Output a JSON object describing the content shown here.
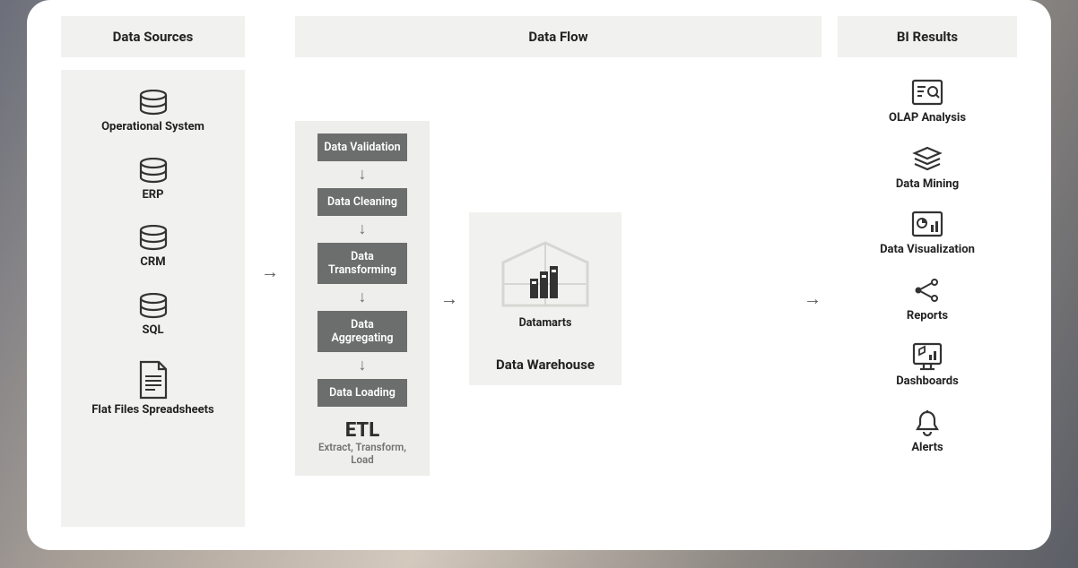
{
  "headers": {
    "sources": "Data Sources",
    "flow": "Data Flow",
    "results": "BI Results"
  },
  "sources": [
    {
      "label": "Operational System",
      "icon": "database"
    },
    {
      "label": "ERP",
      "icon": "database"
    },
    {
      "label": "CRM",
      "icon": "database"
    },
    {
      "label": "SQL",
      "icon": "database"
    },
    {
      "label": "Flat Files Spreadsheets",
      "icon": "file"
    }
  ],
  "etl": {
    "stages": [
      "Data Validation",
      "Data Cleaning",
      "Data Transforming",
      "Data Aggregating",
      "Data Loading"
    ],
    "title": "ETL",
    "subtitle": "Extract, Transform, Load"
  },
  "warehouse": {
    "datamarts_label": "Datamarts",
    "title": "Data Warehouse"
  },
  "results": [
    {
      "label": "OLAP Analysis",
      "icon": "olap"
    },
    {
      "label": "Data Mining",
      "icon": "layers"
    },
    {
      "label": "Data Visualization",
      "icon": "viz"
    },
    {
      "label": "Reports",
      "icon": "share"
    },
    {
      "label": "Dashboards",
      "icon": "dashboard"
    },
    {
      "label": "Alerts",
      "icon": "bell"
    }
  ]
}
